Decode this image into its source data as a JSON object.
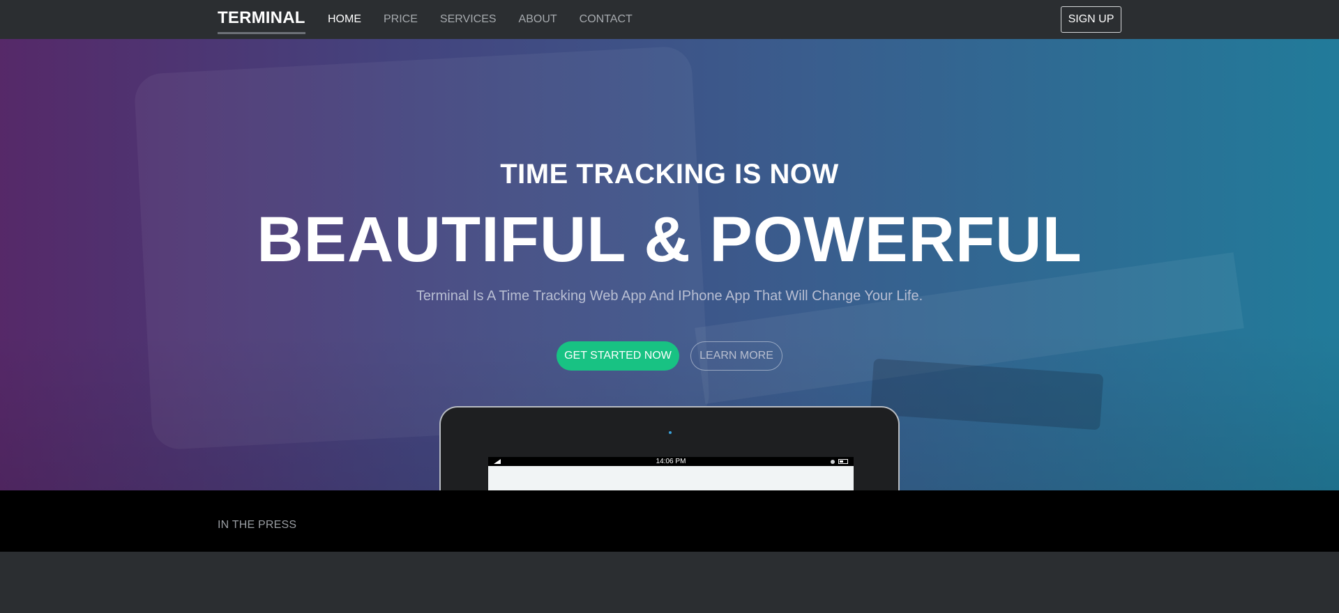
{
  "nav": {
    "brand": "TERMINAL",
    "links": [
      "HOME",
      "PRICE",
      "SERVICES",
      "ABOUT",
      "CONTACT"
    ],
    "active": "HOME",
    "signup_label": "SIGN UP"
  },
  "hero": {
    "headline_small": "TIME TRACKING IS NOW",
    "headline_big": "BEAUTIFUL & POWERFUL",
    "subtitle": "Terminal Is A Time Tracking Web App And IPhone App That Will Change Your Life.",
    "primary_cta": "GET STARTED NOW",
    "secondary_cta": "LEARN MORE"
  },
  "device": {
    "status_time": "14:06 PM",
    "icons": [
      "signal-icon",
      "settings-icon",
      "battery-icon"
    ]
  },
  "press": {
    "label": "IN THE PRESS"
  },
  "colors": {
    "navbar_bg": "#2b2e31",
    "primary_cta": "#18c283",
    "gradient_left": "#582668",
    "gradient_right": "#1e82a0",
    "press_bg": "#000000"
  }
}
